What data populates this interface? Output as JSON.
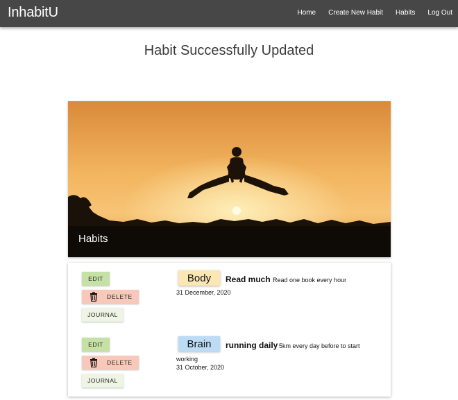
{
  "nav": {
    "brand": "InhabitU",
    "links": [
      "Home",
      "Create New Habit",
      "Habits",
      "Log Out"
    ]
  },
  "page": {
    "title": "Habit Successfully Updated"
  },
  "hero": {
    "title": "Habits"
  },
  "buttons": {
    "edit": "EDIT",
    "delete": "DELETE",
    "journal": "JOURNAL"
  },
  "habits": [
    {
      "category": "Body",
      "category_color": "#fbe7b4",
      "name": "Read much",
      "description": "Read one book every hour",
      "date": "31 December, 2020"
    },
    {
      "category": "Brain",
      "category_color": "#bcdcf6",
      "name": "running daily",
      "description_line1": "5km every day before to start",
      "description_line2": "working",
      "date": "31 October, 2020"
    }
  ],
  "colors": {
    "navbar": "#474747",
    "edit": "#c5e1a5",
    "delete": "#f8c9bb",
    "journal": "#eef5e4"
  }
}
